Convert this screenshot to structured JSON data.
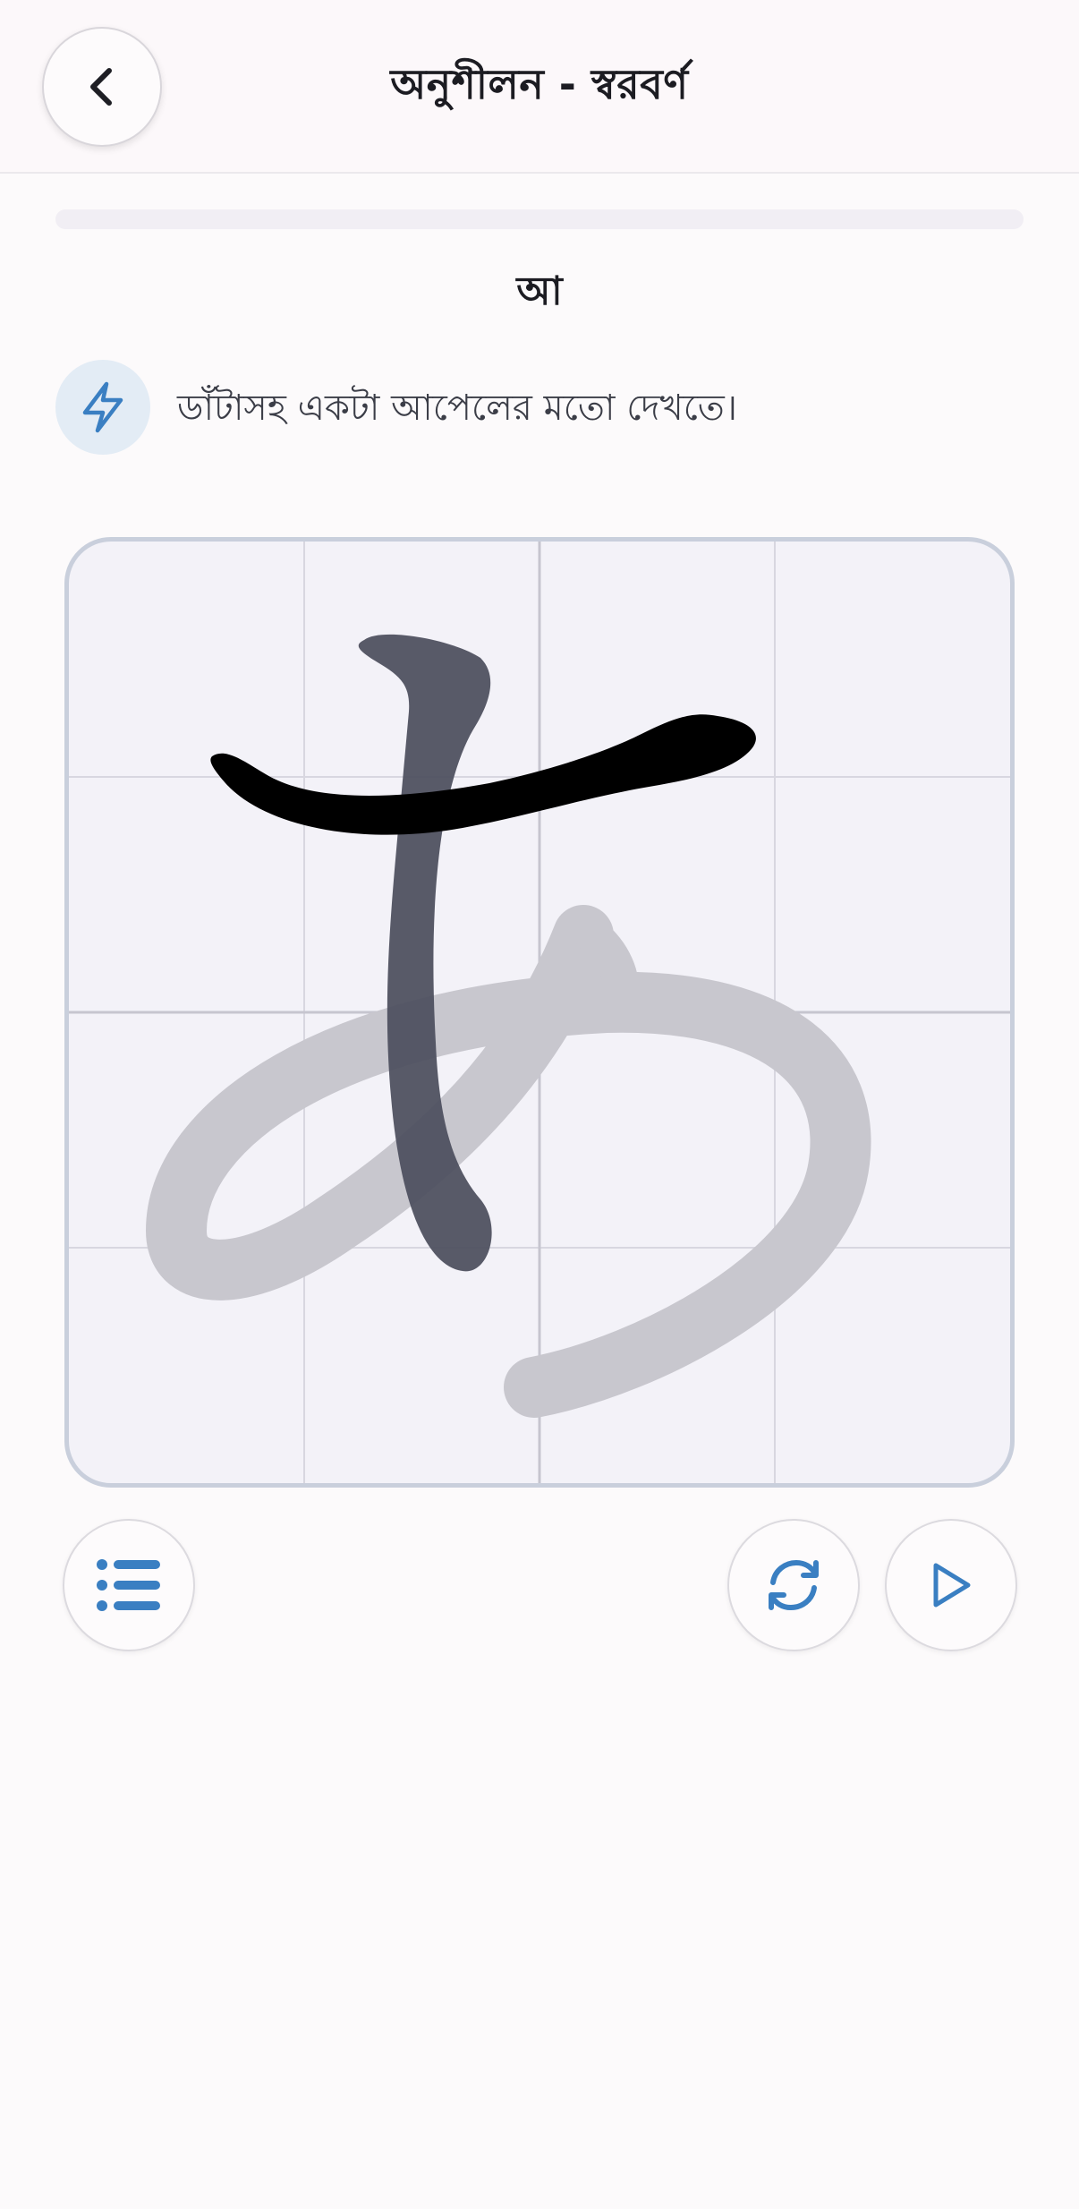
{
  "header": {
    "title": "অনুশীলন - স্বরবর্ণ",
    "back_icon": "chevron-left-icon"
  },
  "progress": {
    "fraction": 0.0,
    "fill_color": "#3a7fc2"
  },
  "character": {
    "label": "আ"
  },
  "hint": {
    "icon": "lightning-icon",
    "text": "ডাঁটাসহ একটা আপেলের মতো দেখতে।"
  },
  "canvas": {
    "grid": true,
    "guide_glyph": "あ",
    "completed_stroke_color": "#000000",
    "active_stroke_color": "#4f5160",
    "guide_color": "#c8c7ce"
  },
  "controls": {
    "list_icon": "list-icon",
    "reset_icon": "refresh-icon",
    "play_icon": "play-icon",
    "accent": "#3a7fc2"
  }
}
